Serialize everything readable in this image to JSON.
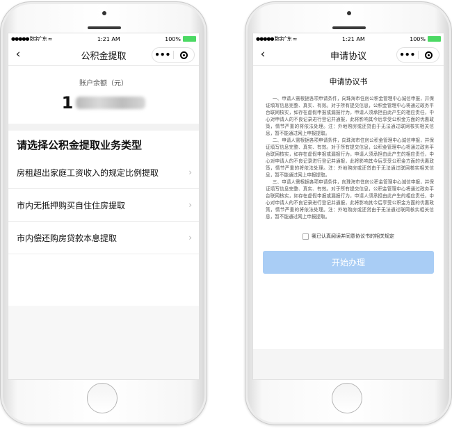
{
  "status_bar": {
    "carrier": "●●●●● 数字广东",
    "wifi": "≈",
    "time": "1:21 AM",
    "battery": "100%"
  },
  "left_screen": {
    "nav_title": "公积金提取",
    "back_icon": "‹",
    "more_icon": "•••",
    "balance_label": "账户余额（元）",
    "balance_visible_digit": "1",
    "section_title": "请选择公积金提取业务类型",
    "items": [
      {
        "label": "房租超出家庭工资收入的规定比例提取"
      },
      {
        "label": "市内无抵押购买自住住房提取"
      },
      {
        "label": "市内偿还购房贷款本息提取"
      }
    ],
    "chevron": "›"
  },
  "right_screen": {
    "nav_title": "申请协议",
    "back_icon": "‹",
    "more_icon": "•••",
    "agreement_title": "申请协议书",
    "paragraphs": [
      "一、申请人需根据各项申请条件，向珠海市住房公积金管理中心诚信申报，并保证填写信息完整、真实、有效。对于所有提交信息，公积金管理中心将通过政务平台联网核实，如存在虚假申报或漏报行为，申请人须承担由此产生的相应责任，中心对申请人的不良记录进行登记并通报，此将影响其今后享受公积金方面的优惠政策，情节严重的将依法处理。注：外地购房或还贷由于无法通过联网核实相关信息，暂不能通过网上申报提取。",
      "二、申请人需根据各项申请条件，向珠海市住房公积金管理中心诚信申报，并保证填写信息完整、真实、有效。对于所有提交信息，公积金管理中心将通过政务平台联网核实，如存在虚假申报或漏报行为，申请人须承担由此产生的相应责任，中心对申请人的不良记录进行登记并通报，此将影响其今后享受公积金方面的优惠政策，情节严重的将依法处理。注：外地购房或还贷由于无法通过联网核实相关信息，暂不能通过网上申报提取。",
      "三、申请人需根据各项申请条件，向珠海市住房公积金管理中心诚信申报，并保证填写信息完整、真实、有效。对于所有提交信息，公积金管理中心将通过政务平台联网核实，如存在虚假申报或漏报行为，申请人须承担由此产生的相应责任，中心对申请人的不良记录进行登记并通报，此将影响其今后享受公积金方面的优惠政策，情节严重的将依法处理。注：外地购房或还贷由于无法通过联网核实相关信息，暂不能通过网上申报提取。"
    ],
    "agree_label": "我已认真阅读并同意协议书的相关规定",
    "agree_checked": false,
    "start_button": "开始办理",
    "start_button_color": "#a9cdf5"
  }
}
